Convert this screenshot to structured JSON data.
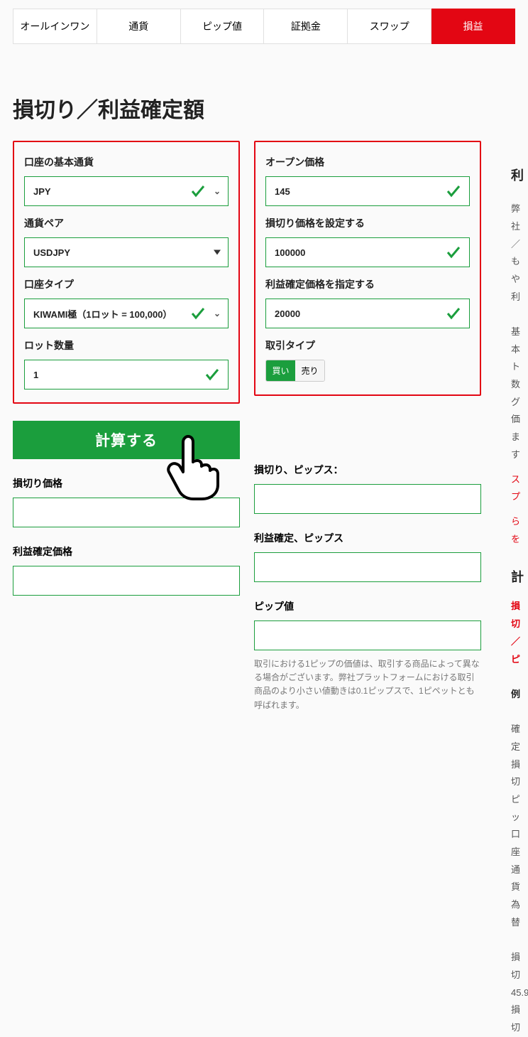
{
  "tabs": {
    "items": [
      {
        "label": "オールインワン"
      },
      {
        "label": "通貨"
      },
      {
        "label": "ピップ値"
      },
      {
        "label": "証拠金"
      },
      {
        "label": "スワップ"
      },
      {
        "label": "損益"
      }
    ],
    "active_index": 5
  },
  "page_title": "損切り／利益確定額",
  "left_form": {
    "base_currency": {
      "label": "口座の基本通貨",
      "value": "JPY"
    },
    "pair": {
      "label": "通貨ペア",
      "value": "USDJPY"
    },
    "account_type": {
      "label": "口座タイプ",
      "value": "KIWAMI極（1ロット = 100,000）"
    },
    "lots": {
      "label": "ロット数量",
      "value": "1"
    }
  },
  "right_form": {
    "open_price": {
      "label": "オープン価格",
      "value": "145"
    },
    "stop_loss": {
      "label": "損切り価格を設定する",
      "value": "100000"
    },
    "take_profit": {
      "label": "利益確定価格を指定する",
      "value": "20000"
    },
    "trade_type": {
      "label": "取引タイプ",
      "buy": "買い",
      "sell": "売り",
      "active": "buy"
    }
  },
  "calc_button": "計算する",
  "results_left": {
    "sl_price": {
      "label": "損切り価格"
    },
    "tp_price": {
      "label": "利益確定価格"
    }
  },
  "results_right": {
    "sl_pips": {
      "label": "損切り、ピップス："
    },
    "tp_pips": {
      "label": "利益確定、ピップス"
    },
    "pip_value": {
      "label": "ピップ値"
    }
  },
  "footnote": "取引における1ピップの価値は、取引する商品によって異なる場合がございます。弊社プラットフォームにおける取引商品のより小さい値動きは0.1ピップスで、1ピペットとも呼ばれます。",
  "sidebar": {
    "heading": "利",
    "p1": "弊社",
    "p2": "／も",
    "p3": "や利",
    "p4": "基本",
    "p5": "ト数",
    "p6": "グ価",
    "p7": "ます",
    "link1": "スプ",
    "link2": "らを",
    "h2": "計",
    "red1": "損切",
    "red2": "／ピ",
    "ex": "例",
    "c1": "確定",
    "c2": "損切",
    "c3": "ピッ",
    "c4": "口座",
    "c5": "通貨",
    "c6": "為替",
    "c7": "損切",
    "c8": "45.9",
    "c9": "損切"
  }
}
